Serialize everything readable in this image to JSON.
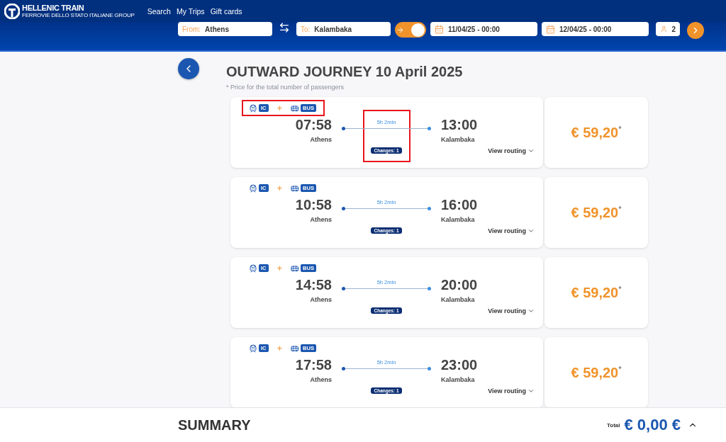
{
  "header": {
    "logo": "HELLENIC TRAIN",
    "logo_subtitle": "FERROVIE DELLO STATO ITALIANE GROUP",
    "nav": [
      "Search",
      "My Trips",
      "Gift cards"
    ]
  },
  "search": {
    "from_label": "From:",
    "from_value": "Athens",
    "to_label": "To:",
    "to_value": "Kalambaka",
    "return_trip": true,
    "outward_date": "11/04/25 - 00:00",
    "return_date": "12/04/25 - 00:00",
    "passengers": "2"
  },
  "title": "OUTWARD JOURNEY 10 April 2025",
  "note": "* Price for the total number of passengers",
  "journeys": [
    {
      "segments": [
        {
          "kind": "train",
          "label": "IC"
        },
        {
          "kind": "bus",
          "label": "BUS"
        }
      ],
      "connector": "+",
      "departure_time": "07:58",
      "departure_station": "Athens",
      "duration": "5h 2min",
      "changes": "Changes: 1",
      "arrival_time": "13:00",
      "arrival_station": "Kalambaka",
      "routing": "View routing",
      "price": "€ 59,20",
      "price_mark": "*",
      "highlighted": true
    },
    {
      "segments": [
        {
          "kind": "train",
          "label": "IC"
        },
        {
          "kind": "bus",
          "label": "BUS"
        }
      ],
      "connector": "+",
      "departure_time": "10:58",
      "departure_station": "Athens",
      "duration": "5h 2min",
      "changes": "Changes: 1",
      "arrival_time": "16:00",
      "arrival_station": "Kalambaka",
      "routing": "View routing",
      "price": "€ 59,20",
      "price_mark": "*",
      "highlighted": false
    },
    {
      "segments": [
        {
          "kind": "train",
          "label": "IC"
        },
        {
          "kind": "bus",
          "label": "BUS"
        }
      ],
      "connector": "+",
      "departure_time": "14:58",
      "departure_station": "Athens",
      "duration": "5h 2min",
      "changes": "Changes: 1",
      "arrival_time": "20:00",
      "arrival_station": "Kalambaka",
      "routing": "View routing",
      "price": "€ 59,20",
      "price_mark": "*",
      "highlighted": false
    },
    {
      "segments": [
        {
          "kind": "train",
          "label": "IC"
        },
        {
          "kind": "bus",
          "label": "BUS"
        }
      ],
      "connector": "+",
      "departure_time": "17:58",
      "departure_station": "Athens",
      "duration": "5h 2min",
      "changes": "Changes: 1",
      "arrival_time": "23:00",
      "arrival_station": "Kalambaka",
      "routing": "View routing",
      "price": "€ 59,20",
      "price_mark": "*",
      "highlighted": false
    }
  ],
  "summary": {
    "title": "SUMMARY",
    "total_label": "Total",
    "total": "€ 0,00 €"
  }
}
